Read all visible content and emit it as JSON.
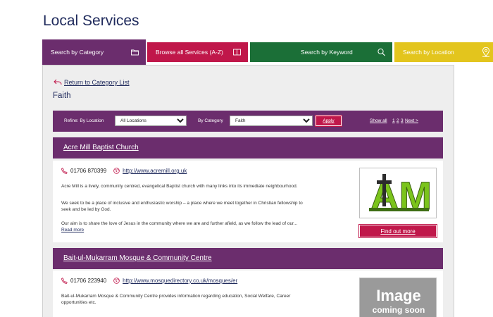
{
  "page": {
    "title": "Local Services"
  },
  "tabs": [
    {
      "label": "Search by Category",
      "icon": "folder-icon",
      "color": "#6b2d6d"
    },
    {
      "label": "Browse all Services (A-Z)",
      "icon": "book-icon",
      "color": "#c0174a"
    },
    {
      "label": "Search by Keyword",
      "icon": "search-icon",
      "color": "#1b6f37"
    },
    {
      "label": "Search by Location",
      "icon": "location-pin-icon",
      "color": "#e3c51d"
    }
  ],
  "nav": {
    "back_label": "Return to Category List",
    "category_title": "Faith"
  },
  "refine": {
    "location_label": "Refine: By Location",
    "location_value": "All Locations",
    "category_label": "By Category",
    "category_value": "Faith",
    "apply_label": "Apply",
    "show_all": "Show all",
    "pages": [
      "1",
      "2",
      "3"
    ],
    "next": "Next >"
  },
  "results": [
    {
      "name": "Acre Mill Baptist Church",
      "phone": "01706 870399",
      "url": "http://www.acremill.org.uk",
      "paragraphs": [
        "Acre Mill is a lively, community centred, evangelical Baptist church with many links into its immediate neighbourhood.",
        "We seek to be a place of inclusive and enthusiastic worship – a place where we meet together in Christian fellowship to seek and be led by God.",
        "Our aim is to share the love of Jesus in the community where we are and further afield, as we follow the lead of our..."
      ],
      "read_more": "Read more",
      "button": "Find out more",
      "logo_text": "AM"
    },
    {
      "name": "Bait-ul-Mukarram Mosque & Community Centre",
      "phone": "01706 223940",
      "url": "http://www.mosquedirectory.co.uk/mosques/er",
      "paragraphs": [
        "Bait-ul-Mukarram Mosque & Community Centre provides information regarding education, Social Welfare, Career opportunities etc."
      ],
      "placeholder_text": [
        "Image",
        "coming soon"
      ]
    }
  ]
}
